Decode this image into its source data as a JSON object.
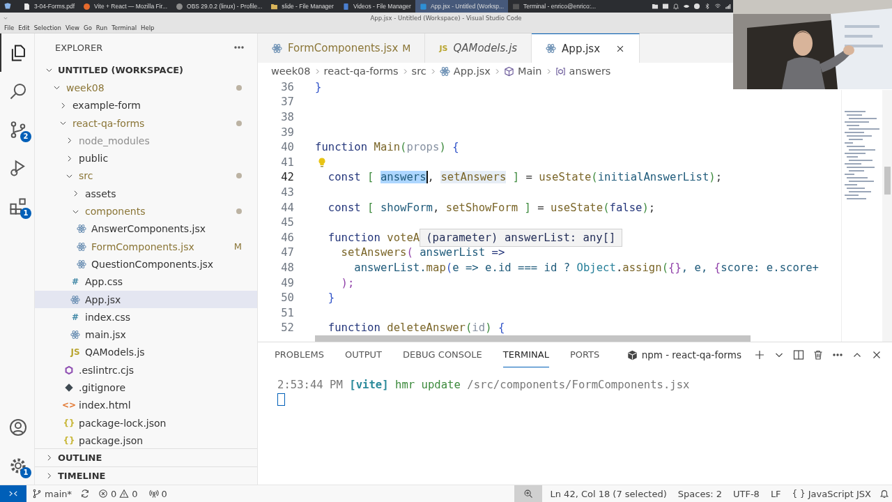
{
  "taskbar": {
    "items": [
      {
        "label": "3-04-Forms.pdf",
        "kind": "document",
        "selected": false
      },
      {
        "label": "Vite + React — Mozilla Fir...",
        "kind": "browser",
        "selected": false
      },
      {
        "label": "OBS 29.0.2 (linux) - Profile...",
        "kind": "record",
        "selected": false
      },
      {
        "label": "slide - File Manager",
        "kind": "folder",
        "selected": false
      },
      {
        "label": "Videos - File Manager",
        "kind": "video",
        "selected": false
      },
      {
        "label": "App.jsx - Untitled (Worksp...",
        "kind": "code",
        "selected": true
      },
      {
        "label": "Terminal - enrico@enrico:...",
        "kind": "terminal",
        "selected": false
      }
    ]
  },
  "window": {
    "title": "App.jsx - Untitled (Workspace) - Visual Studio Code"
  },
  "menu": [
    "File",
    "Edit",
    "Selection",
    "View",
    "Go",
    "Run",
    "Terminal",
    "Help"
  ],
  "activity_bar": {
    "items": [
      {
        "kind": "files",
        "selected": true
      },
      {
        "kind": "search",
        "selected": false
      },
      {
        "kind": "scm",
        "selected": false,
        "badge": "2"
      },
      {
        "kind": "debug",
        "selected": false
      },
      {
        "kind": "extensions",
        "selected": false,
        "badge": "1"
      }
    ],
    "bottom": [
      {
        "kind": "account"
      },
      {
        "kind": "manage",
        "badge": "1"
      }
    ]
  },
  "sidebar": {
    "title": "EXPLORER",
    "workspace": {
      "label": "UNTITLED (WORKSPACE)",
      "expanded": true,
      "items": [
        {
          "label": "week08",
          "kind": "folder",
          "expanded": true,
          "modified": true,
          "ignored": false,
          "selected": false,
          "children": [
            {
              "label": "example-form",
              "kind": "folder",
              "expanded": false,
              "modified": false,
              "ignored": false,
              "selected": false
            },
            {
              "label": "react-qa-forms",
              "kind": "folder",
              "expanded": true,
              "modified": true,
              "ignored": false,
              "selected": false,
              "children": [
                {
                  "label": "node_modules",
                  "kind": "folder",
                  "expanded": false,
                  "modified": false,
                  "ignored": true,
                  "selected": false
                },
                {
                  "label": "public",
                  "kind": "folder",
                  "expanded": false,
                  "modified": false,
                  "ignored": false,
                  "selected": false
                },
                {
                  "label": "src",
                  "kind": "folder",
                  "expanded": true,
                  "modified": true,
                  "ignored": false,
                  "selected": false,
                  "children": [
                    {
                      "label": "assets",
                      "kind": "folder",
                      "expanded": false,
                      "modified": false,
                      "ignored": false,
                      "selected": false
                    },
                    {
                      "label": "components",
                      "kind": "folder",
                      "expanded": true,
                      "modified": true,
                      "ignored": false,
                      "selected": false,
                      "children": [
                        {
                          "label": "AnswerComponents.jsx",
                          "kind": "react",
                          "modified": false,
                          "ignored": false,
                          "selected": false
                        },
                        {
                          "label": "FormComponents.jsx",
                          "kind": "react",
                          "modified": true,
                          "ignored": false,
                          "badge": "M",
                          "selected": false
                        },
                        {
                          "label": "QuestionComponents.jsx",
                          "kind": "react",
                          "modified": false,
                          "ignored": false,
                          "selected": false
                        }
                      ]
                    },
                    {
                      "label": "App.css",
                      "kind": "glyph",
                      "glyph": "#",
                      "color": "#3e86a5",
                      "modified": false,
                      "ignored": false,
                      "selected": false
                    },
                    {
                      "label": "App.jsx",
                      "kind": "react",
                      "modified": false,
                      "ignored": false,
                      "selected": true
                    },
                    {
                      "label": "index.css",
                      "kind": "glyph",
                      "glyph": "#",
                      "color": "#3e86a5",
                      "modified": false,
                      "ignored": false,
                      "selected": false
                    },
                    {
                      "label": "main.jsx",
                      "kind": "react",
                      "modified": false,
                      "ignored": false,
                      "selected": false
                    },
                    {
                      "label": "QAModels.js",
                      "kind": "glyph",
                      "glyph": "JS",
                      "color": "#b9a530",
                      "modified": false,
                      "ignored": false,
                      "selected": false
                    }
                  ]
                },
                {
                  "label": ".eslintrc.cjs",
                  "kind": "eslint",
                  "modified": false,
                  "ignored": false,
                  "selected": false
                },
                {
                  "label": ".gitignore",
                  "kind": "git",
                  "modified": false,
                  "ignored": false,
                  "selected": false
                },
                {
                  "label": "index.html",
                  "kind": "glyph",
                  "glyph": "<>",
                  "color": "#e37933",
                  "modified": false,
                  "ignored": false,
                  "selected": false
                },
                {
                  "label": "package-lock.json",
                  "kind": "glyph",
                  "glyph": "{}",
                  "color": "#c9b83c",
                  "modified": false,
                  "ignored": false,
                  "selected": false
                },
                {
                  "label": "package.json",
                  "kind": "glyph",
                  "glyph": "{}",
                  "color": "#c9b83c",
                  "modified": false,
                  "ignored": false,
                  "selected": false
                }
              ]
            }
          ]
        }
      ]
    },
    "sections": [
      {
        "label": "OUTLINE",
        "expanded": false
      },
      {
        "label": "TIMELINE",
        "expanded": false
      }
    ]
  },
  "tabs": [
    {
      "label": "FormComponents.jsx",
      "kind": "react",
      "badge": "M",
      "modified": true,
      "preview": false,
      "selected": false
    },
    {
      "label": "QAModels.js",
      "kind": "glyph",
      "glyph": "JS",
      "modified": false,
      "preview": true,
      "selected": false
    },
    {
      "label": "App.jsx",
      "kind": "react",
      "modified": false,
      "preview": false,
      "selected": true
    }
  ],
  "breadcrumbs": [
    {
      "label": "week08"
    },
    {
      "label": "react-qa-forms"
    },
    {
      "label": "src"
    },
    {
      "label": "App.jsx",
      "kind": "react"
    },
    {
      "label": "Main",
      "kind": "module"
    },
    {
      "label": "answers",
      "kind": "variable"
    }
  ],
  "editor": {
    "lines": [
      {
        "number": "36",
        "kind": "code",
        "current": false,
        "tokens": [
          {
            "t": "}",
            "kind": "b1"
          }
        ]
      },
      {
        "number": "37",
        "kind": "blank",
        "current": false
      },
      {
        "number": "38",
        "kind": "blank",
        "current": false
      },
      {
        "number": "39",
        "kind": "blank",
        "current": false
      },
      {
        "number": "40",
        "kind": "code",
        "current": false,
        "tokens": [
          {
            "t": "function ",
            "kind": "kw"
          },
          {
            "t": "Main",
            "kind": "fn"
          },
          {
            "t": "(",
            "kind": "b2"
          },
          {
            "t": "props",
            "kind": "param"
          },
          {
            "t": ") ",
            "kind": "b2"
          },
          {
            "t": "{",
            "kind": "b1"
          }
        ]
      },
      {
        "number": "41",
        "kind": "lightbulb",
        "current": false
      },
      {
        "number": "42",
        "kind": "code",
        "current": true,
        "tokens": [
          {
            "t": "  const ",
            "kind": "kw"
          },
          {
            "t": "[ ",
            "kind": "b2"
          },
          {
            "t": "answers",
            "kind": "sel"
          },
          {
            "t": ", ",
            "kind": "op"
          },
          {
            "t": "setAnswers",
            "kind": "occ"
          },
          {
            "t": " ] ",
            "kind": "b2"
          },
          {
            "t": "= ",
            "kind": "op"
          },
          {
            "t": "useState",
            "kind": "fn"
          },
          {
            "t": "(",
            "kind": "b2"
          },
          {
            "t": "initialAnswerList",
            "kind": "var"
          },
          {
            "t": ")",
            "kind": "b2"
          },
          {
            "t": ";",
            "kind": "op"
          }
        ]
      },
      {
        "number": "43",
        "kind": "blank",
        "current": false
      },
      {
        "number": "44",
        "kind": "code",
        "current": false,
        "tokens": [
          {
            "t": "  const ",
            "kind": "kw"
          },
          {
            "t": "[ ",
            "kind": "b2"
          },
          {
            "t": "showForm",
            "kind": "var"
          },
          {
            "t": ", ",
            "kind": "op"
          },
          {
            "t": "setShowForm",
            "kind": "fn"
          },
          {
            "t": " ] ",
            "kind": "b2"
          },
          {
            "t": "= ",
            "kind": "op"
          },
          {
            "t": "useState",
            "kind": "fn"
          },
          {
            "t": "(",
            "kind": "b2"
          },
          {
            "t": "false",
            "kind": "kw"
          },
          {
            "t": ")",
            "kind": "b2"
          },
          {
            "t": ";",
            "kind": "op"
          }
        ]
      },
      {
        "number": "45",
        "kind": "blank",
        "current": false
      },
      {
        "number": "46",
        "kind": "code",
        "current": false,
        "tokens": [
          {
            "t": "  function ",
            "kind": "kw"
          },
          {
            "t": "voteA",
            "kind": "fn"
          }
        ],
        "hover": "(parameter) answerList: any[]"
      },
      {
        "number": "47",
        "kind": "code",
        "current": false,
        "tokens": [
          {
            "t": "    setAnswers",
            "kind": "fn"
          },
          {
            "t": "( ",
            "kind": "b3"
          },
          {
            "t": "answerList",
            "kind": "var"
          },
          {
            "t": " =>",
            "kind": "kw"
          }
        ]
      },
      {
        "number": "48",
        "kind": "code",
        "current": false,
        "tokens": [
          {
            "t": "      answerList.",
            "kind": "var"
          },
          {
            "t": "map",
            "kind": "fn"
          },
          {
            "t": "(",
            "kind": "b1"
          },
          {
            "t": "e => e.id === id ? ",
            "kind": "var"
          },
          {
            "t": "Object",
            "kind": "type"
          },
          {
            "t": ".",
            "kind": "op"
          },
          {
            "t": "assign",
            "kind": "fn"
          },
          {
            "t": "(",
            "kind": "b2"
          },
          {
            "t": "{}",
            "kind": "b3"
          },
          {
            "t": ", e, ",
            "kind": "var"
          },
          {
            "t": "{",
            "kind": "b3"
          },
          {
            "t": "score: e.score+",
            "kind": "var"
          }
        ]
      },
      {
        "number": "49",
        "kind": "code",
        "current": false,
        "tokens": [
          {
            "t": "    );",
            "kind": "b3"
          }
        ]
      },
      {
        "number": "50",
        "kind": "code",
        "current": false,
        "tokens": [
          {
            "t": "  }",
            "kind": "b1"
          }
        ]
      },
      {
        "number": "51",
        "kind": "blank",
        "current": false
      },
      {
        "number": "52",
        "kind": "code",
        "current": false,
        "tokens": [
          {
            "t": "  function ",
            "kind": "kw"
          },
          {
            "t": "deleteAnswer",
            "kind": "fn"
          },
          {
            "t": "(",
            "kind": "b2"
          },
          {
            "t": "id",
            "kind": "param"
          },
          {
            "t": ") ",
            "kind": "b2"
          },
          {
            "t": "{",
            "kind": "b1"
          }
        ]
      }
    ]
  },
  "panel": {
    "tabs": [
      {
        "label": "PROBLEMS",
        "selected": false
      },
      {
        "label": "OUTPUT",
        "selected": false
      },
      {
        "label": "DEBUG CONSOLE",
        "selected": false
      },
      {
        "label": "TERMINAL",
        "selected": true
      },
      {
        "label": "PORTS",
        "selected": false
      }
    ],
    "terminal_name": "npm - react-qa-forms",
    "terminal": [
      {
        "parts": [
          {
            "t": "2:53:44 PM ",
            "kind": "time"
          },
          {
            "t": "[vite]",
            "kind": "tag"
          },
          {
            "t": " hmr update ",
            "kind": "msg"
          },
          {
            "t": "/src/components/FormComponents.jsx",
            "kind": "path"
          }
        ]
      }
    ]
  },
  "status_bar": {
    "branch": "main*",
    "errors": "0",
    "warnings": "0",
    "ports": "0",
    "items": [
      "Ln 42, Col 18 (7 selected)",
      "Spaces: 2",
      "UTF-8",
      "LF"
    ],
    "language": {
      "glyph": "{ }",
      "label": "JavaScript JSX"
    }
  }
}
